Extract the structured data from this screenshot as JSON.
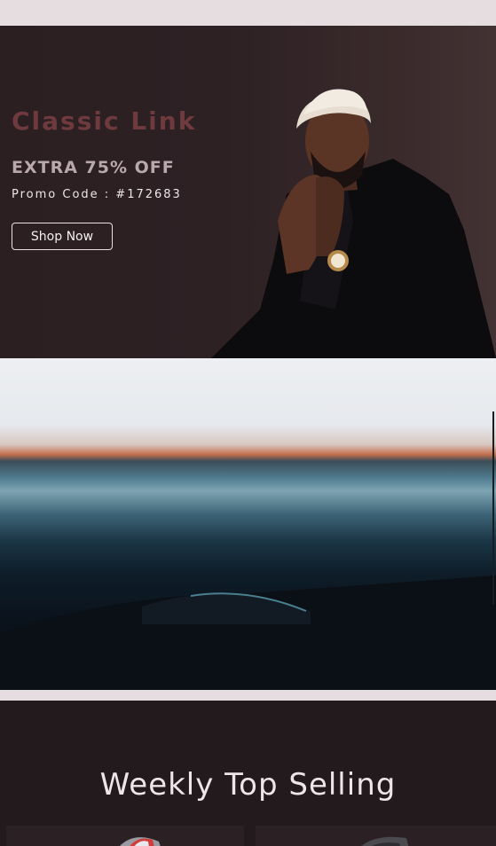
{
  "hero": {
    "title": "Classic Link",
    "offer": "EXTRA 75% OFF",
    "promo": "Promo Code : #172683",
    "button_label": "Shop Now"
  },
  "weekly": {
    "title": "Weekly Top Selling"
  }
}
